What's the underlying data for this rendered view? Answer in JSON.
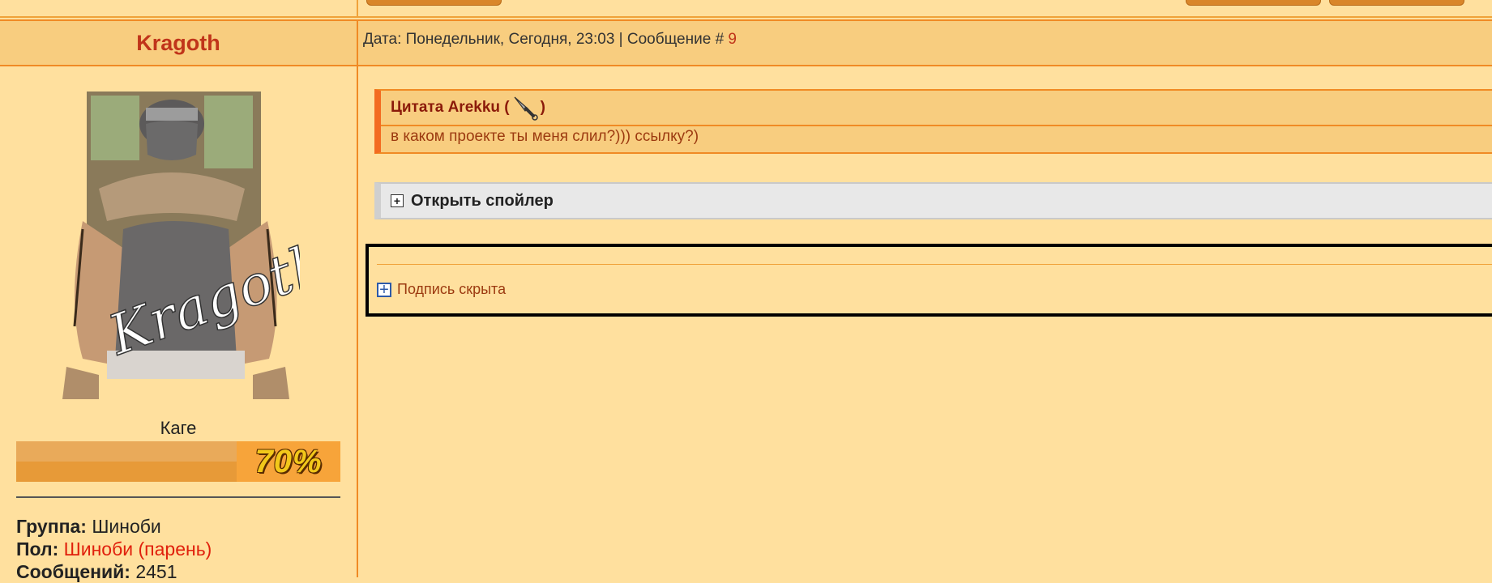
{
  "post": {
    "author": "Kragoth",
    "meta_prefix": "Дата: Понедельник, Сегодня, 23:03 | Сообщение # ",
    "number": "9"
  },
  "profile": {
    "rank": "Каге",
    "rank_progress_label": "70%",
    "rank_progress": 0.7,
    "group_label": "Группа:",
    "group_value": "Шиноби",
    "gender_label": "Пол:",
    "gender_value": "Шиноби (парень)",
    "messages_label": "Сообщений:",
    "messages_value": "2451",
    "avatar_caption": "Kragoth"
  },
  "quote": {
    "title_prefix": "Цитата Arekku (",
    "title_suffix": ")",
    "icon": "kunai-icon",
    "text": "в каком проекте ты меня слил?))) ссылку?)"
  },
  "spoiler": {
    "label": "Открыть спойлер"
  },
  "signature": {
    "label": "Подпись скрыта"
  },
  "colors": {
    "background": "#ffe09e",
    "header": "#f8cd7f",
    "border": "#f08a24",
    "author": "#c0341a",
    "quote_accent": "#f36b20"
  }
}
